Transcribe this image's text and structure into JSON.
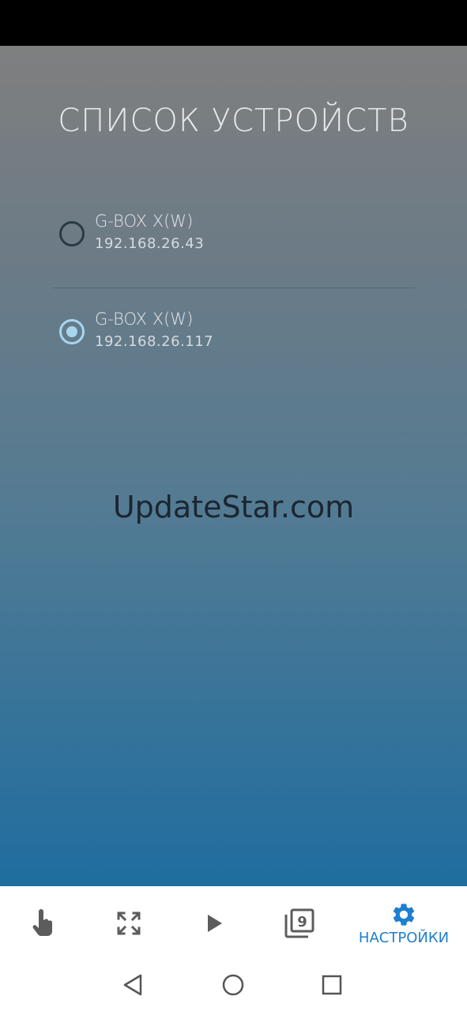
{
  "title": "СПИСОК УСТРОЙСТВ",
  "devices": [
    {
      "name": "G-BOX X(W)",
      "ip": "192.168.26.43",
      "selected": false
    },
    {
      "name": "G-BOX X(W)",
      "ip": "192.168.26.117",
      "selected": true
    }
  ],
  "watermark": "UpdateStar.com",
  "bottom_nav": {
    "items": [
      {
        "icon": "touch-icon"
      },
      {
        "icon": "fullscreen-icon"
      },
      {
        "icon": "play-icon"
      },
      {
        "icon": "filter-9-icon",
        "badge": "9"
      },
      {
        "icon": "settings-gear-icon",
        "label": "НАСТРОЙКИ",
        "active": true
      }
    ]
  },
  "colors": {
    "accent": "#1e7fd0",
    "radio_selected": "#a9d6ee",
    "radio_unselected": "#2a3a43"
  }
}
